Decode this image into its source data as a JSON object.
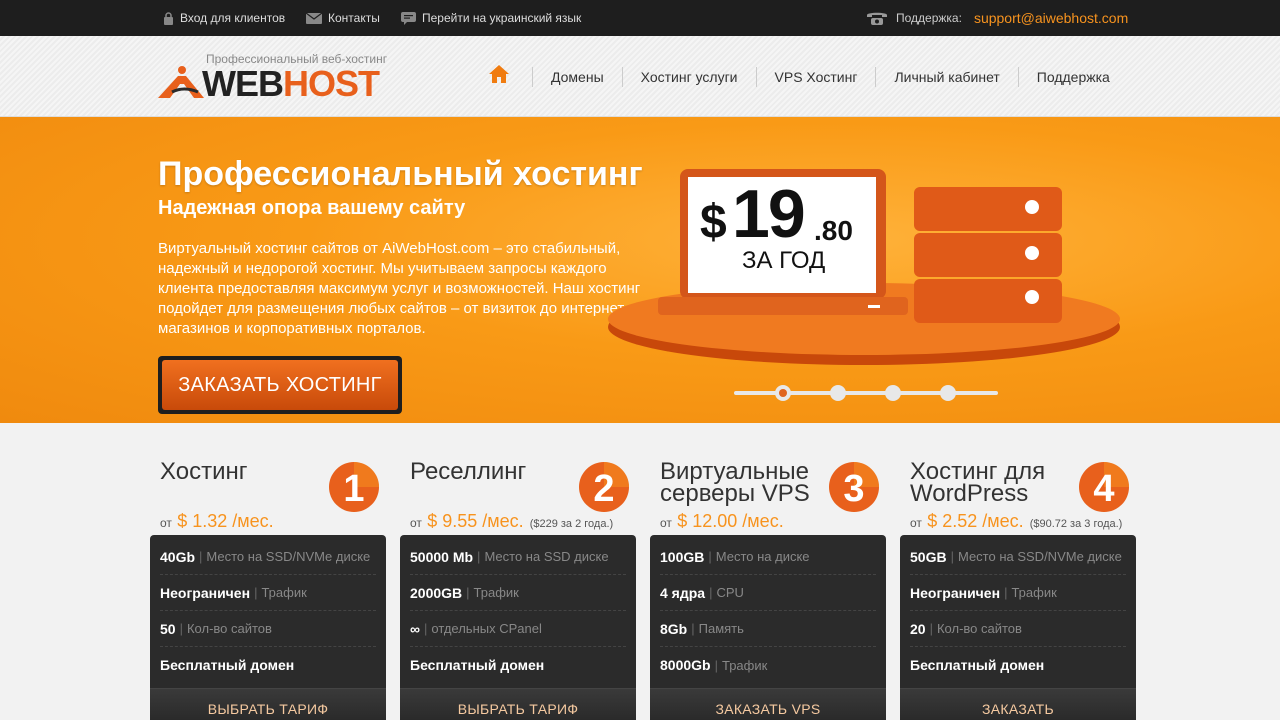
{
  "topbar": {
    "client_login": "Вход для клиентов",
    "contacts": "Контакты",
    "lang_switch": "Перейти на украинский язык",
    "support_label": "Поддержка:",
    "support_email": "support@aiwebhost.com"
  },
  "logo": {
    "slogan": "Профессиональный веб-хостинг",
    "word_web": "WEB",
    "word_host": "HOST"
  },
  "nav": {
    "items": [
      "Домены",
      "Хостинг услуги",
      "VPS Хостинг",
      "Личный кабинет",
      "Поддержка"
    ]
  },
  "banner": {
    "title": "Профессиональный хостинг",
    "subtitle": "Надежная опора вашему сайту",
    "description": "Виртуальный хостинг сайтов от AiWebHost.com – это стабильный, надежный и недорогой хостинг. Мы учитываем запросы каждого клиента предоставляя максимум услуг и возможностей. Наш хостинг подойдет для размещения любых сайтов – от визиток до интернет-магазинов и корпоративных порталов.",
    "order_button": "ЗАКАЗАТЬ ХОСТИНГ",
    "price_currency": "$",
    "price_main": "19",
    "price_cents": ".80",
    "price_period": "ЗА ГОД",
    "slide_count": 4,
    "active_slide": 1
  },
  "colors": {
    "accent": "#f7931e",
    "brand_orange": "#e8601c",
    "dark": "#2b2b2b"
  },
  "plans": [
    {
      "title": "Хостинг",
      "number": "1",
      "from": "от",
      "price": "$ 1.32 /мес.",
      "note": "",
      "rows": [
        {
          "value": "40Gb",
          "label": "Место на SSD/NVMe диске"
        },
        {
          "value": "Неограничен",
          "label": "Трафик"
        },
        {
          "value": "50",
          "label": "Кол-во сайтов"
        },
        {
          "value": "Бесплатный домен",
          "label": ""
        }
      ],
      "cta": "ВЫБРАТЬ ТАРИФ"
    },
    {
      "title": "Реселлинг",
      "number": "2",
      "from": "от",
      "price": "$ 9.55 /мес.",
      "note": "($229 за 2 года.)",
      "rows": [
        {
          "value": "50000 Mb",
          "label": "Место на SSD диске"
        },
        {
          "value": "2000GB",
          "label": "Трафик"
        },
        {
          "value": "∞",
          "label": "отдельных CPanel"
        },
        {
          "value": "Бесплатный домен",
          "label": ""
        }
      ],
      "cta": "ВЫБРАТЬ ТАРИФ"
    },
    {
      "title": "Виртуальные серверы VPS",
      "number": "3",
      "from": "от",
      "price": "$ 12.00 /мес.",
      "note": "",
      "rows": [
        {
          "value": "100GB",
          "label": "Место на диске"
        },
        {
          "value": "4 ядра",
          "label": "CPU"
        },
        {
          "value": "8Gb",
          "label": "Память"
        },
        {
          "value": "8000Gb",
          "label": "Трафик"
        }
      ],
      "cta": "ЗАКАЗАТЬ VPS"
    },
    {
      "title": "Хостинг для WordPress",
      "number": "4",
      "from": "от",
      "price": "$ 2.52 /мес.",
      "note": "($90.72 за 3 года.)",
      "rows": [
        {
          "value": "50GB",
          "label": "Место на SSD/NVMe диске"
        },
        {
          "value": "Неограничен",
          "label": "Трафик"
        },
        {
          "value": "20",
          "label": "Кол-во сайтов"
        },
        {
          "value": "Бесплатный домен",
          "label": ""
        }
      ],
      "cta": "ЗАКАЗАТЬ"
    }
  ]
}
